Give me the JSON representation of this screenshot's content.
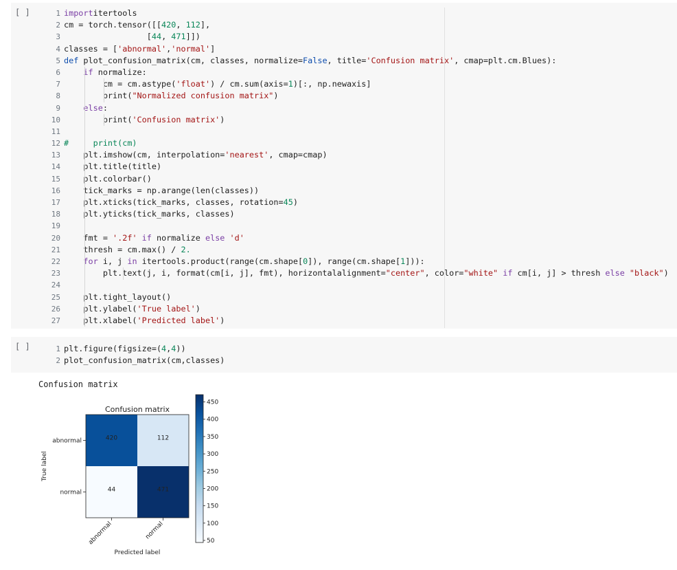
{
  "cell1": {
    "run_label": "[ ]",
    "lines": [
      {
        "n": "1",
        "tokens": [
          [
            "kw",
            "import"
          ],
          [
            "",
            "itertools"
          ]
        ]
      },
      {
        "n": "2",
        "tokens": [
          [
            "",
            "cm = torch.tensor([["
          ],
          [
            "num",
            "420"
          ],
          [
            "",
            ", "
          ],
          [
            "num",
            "112"
          ],
          [
            "",
            "],"
          ]
        ]
      },
      {
        "n": "3",
        "tokens": [
          [
            "",
            "                 ["
          ],
          [
            "num",
            "44"
          ],
          [
            "",
            ", "
          ],
          [
            "num",
            "471"
          ],
          [
            "",
            "]])"
          ]
        ]
      },
      {
        "n": "4",
        "tokens": [
          [
            "",
            "classes = ["
          ],
          [
            "str",
            "'abnormal'"
          ],
          [
            "",
            ","
          ],
          [
            "str",
            "'normal'"
          ],
          [
            "",
            "]"
          ]
        ]
      },
      {
        "n": "5",
        "tokens": [
          [
            "kwb",
            "def"
          ],
          [
            "",
            " plot_confusion_matrix(cm, classes, normalize="
          ],
          [
            "kwb",
            "False"
          ],
          [
            "",
            ", title="
          ],
          [
            "str",
            "'Confusion matrix'"
          ],
          [
            "",
            ", cmap=plt.cm.Blues):"
          ]
        ]
      },
      {
        "n": "6",
        "tokens": [
          [
            "",
            "    "
          ],
          [
            "kw",
            "if"
          ],
          [
            "",
            " normalize:"
          ]
        ]
      },
      {
        "n": "7",
        "tokens": [
          [
            "",
            "        cm = cm.astype("
          ],
          [
            "str",
            "'float'"
          ],
          [
            "",
            ") / cm.sum(axis="
          ],
          [
            "num",
            "1"
          ],
          [
            "",
            ")[:, np.newaxis]"
          ]
        ]
      },
      {
        "n": "8",
        "tokens": [
          [
            "",
            "        print("
          ],
          [
            "str",
            "\"Normalized confusion matrix\""
          ],
          [
            "",
            ")"
          ]
        ]
      },
      {
        "n": "9",
        "tokens": [
          [
            "",
            "    "
          ],
          [
            "kw",
            "else"
          ],
          [
            "",
            ":"
          ]
        ]
      },
      {
        "n": "10",
        "tokens": [
          [
            "",
            "        print("
          ],
          [
            "str",
            "'Confusion matrix'"
          ],
          [
            "",
            ")"
          ]
        ]
      },
      {
        "n": "11",
        "tokens": []
      },
      {
        "n": "12",
        "tokens": [
          [
            "cm",
            "#     print(cm)"
          ]
        ]
      },
      {
        "n": "13",
        "tokens": [
          [
            "",
            "    plt.imshow(cm, interpolation="
          ],
          [
            "str",
            "'nearest'"
          ],
          [
            "",
            ", cmap=cmap)"
          ]
        ]
      },
      {
        "n": "14",
        "tokens": [
          [
            "",
            "    plt.title(title)"
          ]
        ]
      },
      {
        "n": "15",
        "tokens": [
          [
            "",
            "    plt.colorbar()"
          ]
        ]
      },
      {
        "n": "16",
        "tokens": [
          [
            "",
            "    tick_marks = np.arange(len(classes))"
          ]
        ]
      },
      {
        "n": "17",
        "tokens": [
          [
            "",
            "    plt.xticks(tick_marks, classes, rotation="
          ],
          [
            "num",
            "45"
          ],
          [
            "",
            ")"
          ]
        ]
      },
      {
        "n": "18",
        "tokens": [
          [
            "",
            "    plt.yticks(tick_marks, classes)"
          ]
        ]
      },
      {
        "n": "19",
        "tokens": []
      },
      {
        "n": "20",
        "tokens": [
          [
            "",
            "    fmt = "
          ],
          [
            "str",
            "'.2f'"
          ],
          [
            "kw",
            " if"
          ],
          [
            "",
            " normalize "
          ],
          [
            "kw",
            "else"
          ],
          [
            "str",
            " 'd'"
          ]
        ]
      },
      {
        "n": "21",
        "tokens": [
          [
            "",
            "    thresh = cm.max() / "
          ],
          [
            "num",
            "2."
          ]
        ]
      },
      {
        "n": "22",
        "tokens": [
          [
            "",
            "    "
          ],
          [
            "kw",
            "for"
          ],
          [
            "",
            " i, j "
          ],
          [
            "kw",
            "in"
          ],
          [
            "",
            " itertools.product(range(cm.shape["
          ],
          [
            "num",
            "0"
          ],
          [
            "",
            "]), range(cm.shape["
          ],
          [
            "num",
            "1"
          ],
          [
            "",
            "])):"
          ]
        ]
      },
      {
        "n": "23",
        "tokens": [
          [
            "",
            "        plt.text(j, i, format(cm[i, j], fmt), horizontalalignment="
          ],
          [
            "str",
            "\"center\""
          ],
          [
            "",
            ", color="
          ],
          [
            "str",
            "\"white\""
          ],
          [
            "kw",
            " if"
          ],
          [
            "",
            " cm[i, j] > thresh "
          ],
          [
            "kw",
            "else"
          ],
          [
            "str",
            " \"black\""
          ],
          [
            "",
            ")"
          ]
        ]
      },
      {
        "n": "24",
        "tokens": []
      },
      {
        "n": "25",
        "tokens": [
          [
            "",
            "    plt.tight_layout()"
          ]
        ]
      },
      {
        "n": "26",
        "tokens": [
          [
            "",
            "    plt.ylabel("
          ],
          [
            "str",
            "'True label'"
          ],
          [
            "",
            ")"
          ]
        ]
      },
      {
        "n": "27",
        "tokens": [
          [
            "",
            "    plt.xlabel("
          ],
          [
            "str",
            "'Predicted label'"
          ],
          [
            "",
            ")"
          ]
        ]
      }
    ]
  },
  "cell2": {
    "run_label": "[ ]",
    "lines": [
      {
        "n": "1",
        "tokens": [
          [
            "",
            "plt.figure(figsize=("
          ],
          [
            "num",
            "4"
          ],
          [
            "",
            ","
          ],
          [
            "num",
            "4"
          ],
          [
            "",
            "))"
          ]
        ]
      },
      {
        "n": "2",
        "tokens": [
          [
            "",
            "plot_confusion_matrix(cm,classes)"
          ]
        ]
      }
    ]
  },
  "output": {
    "printed_text": "Confusion matrix"
  },
  "chart_data": {
    "type": "heatmap",
    "title": "Confusion matrix",
    "xlabel": "Predicted label",
    "ylabel": "True label",
    "x_categories": [
      "abnormal",
      "normal"
    ],
    "y_categories": [
      "abnormal",
      "normal"
    ],
    "values": [
      [
        420,
        112
      ],
      [
        44,
        471
      ]
    ],
    "colormap": "Blues",
    "colorbar": {
      "min": 44,
      "max": 471,
      "ticks": [
        50,
        100,
        150,
        200,
        250,
        300,
        350,
        400,
        450
      ]
    },
    "text_colors": {
      "dark_cell": "#ffffff",
      "light_cell": "#000000"
    }
  }
}
